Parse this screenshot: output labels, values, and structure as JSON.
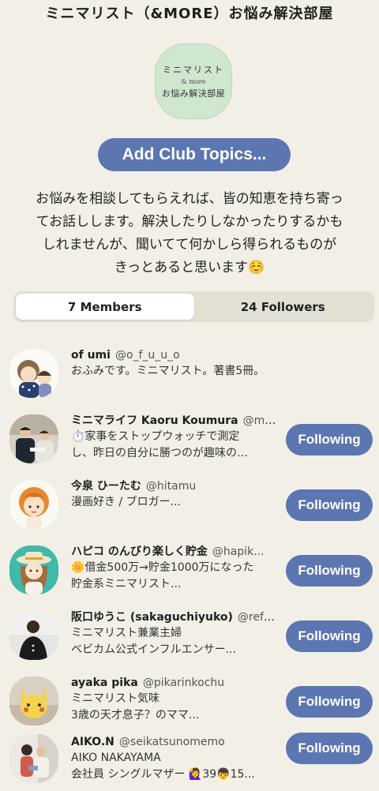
{
  "club": {
    "title": "ミニマリスト（&MORE）お悩み解決部屋",
    "icon_text": {
      "line1": "ミニマリスト",
      "line2": "& more",
      "line3": "お悩み解決部屋"
    },
    "icon_color": "#cfe6cf",
    "add_topics_label": "Add Club Topics...",
    "description_lines": [
      "お悩みを相談してもらえれば、皆の知恵を持ち寄っ",
      "てお話しします。解決したりしなかったりするかも",
      "しれませんが、聞いてて何かしら得られるものが",
      "きっとあると思います☺️"
    ]
  },
  "tabs": {
    "members": "7 Members",
    "followers": "24 Followers",
    "active": "members"
  },
  "accent_color": "#5c76b1",
  "members": [
    {
      "name": "of umi",
      "handle": "@o_f_u_u_o",
      "bio1": "おふみです。ミニマリスト。著書5冊。",
      "bio2": "",
      "button": ""
    },
    {
      "name": "ミニマライフ Kaoru Koumura",
      "handle": "@mi...",
      "bio1": "⏱️家事をストップウォッチで測定",
      "bio2": "し、昨日の自分に勝つのが趣味の…",
      "button": "Following"
    },
    {
      "name": "今泉 ひーたむ",
      "handle": "@hitamu",
      "bio1": "漫画好き / ブロガー...",
      "bio2": "",
      "button": "Following"
    },
    {
      "name": "ハピコ のんびり楽しく貯金",
      "handle": "@hapik...",
      "bio1": "🌼借金500万→貯金1000万になった",
      "bio2": "貯金系ミニマリスト...",
      "button": "Following"
    },
    {
      "name": "阪口ゆうこ (sakaguchiyuko)",
      "handle": "@refre...",
      "bio1": "ミニマリスト兼業主婦",
      "bio2": "ベビカム公式インフルエンサー...",
      "button": "Following"
    },
    {
      "name": "ayaka pika",
      "handle": "@pikarinkochu",
      "bio1": "ミニマリスト気味",
      "bio2": "3歳の天才息子？のママ...",
      "button": "Following"
    },
    {
      "name": "AIKO.N",
      "handle": "@seikatsunomemo",
      "bio1": "AIKO NAKAYAMA",
      "bio2": "会社員 シングルマザー 🙋‍♀️39👦15...",
      "button": "Following"
    }
  ]
}
